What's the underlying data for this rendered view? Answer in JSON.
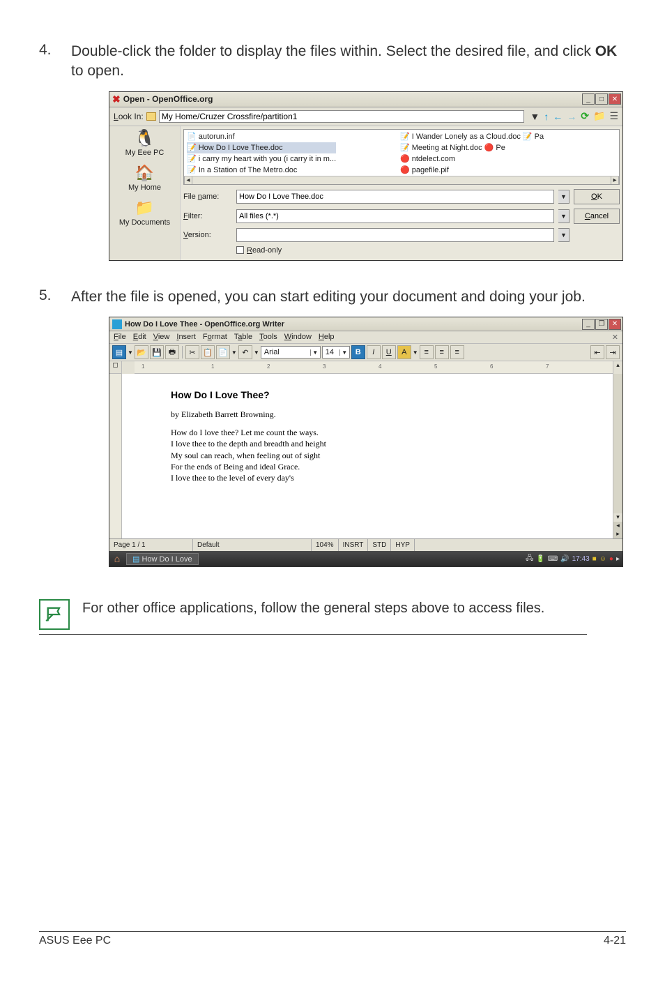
{
  "steps": {
    "s4": {
      "num": "4.",
      "text_a": "Double-click the folder to display the files within. Select the desired file, and click ",
      "bold": "OK",
      "text_b": " to open."
    },
    "s5": {
      "num": "5.",
      "text": "After the file is opened, you can start editing your document and doing your job."
    }
  },
  "open_dialog": {
    "title": "Open - OpenOffice.org",
    "lookin_label": "Look In:",
    "lookin_value": "My Home/Cruzer Crossfire/partition1",
    "places": {
      "eeepc": "My Eee PC",
      "home": "My Home",
      "docs": "My Documents"
    },
    "files_left": [
      {
        "ico": "📄",
        "name": "autorun.inf"
      },
      {
        "ico": "📝",
        "name": "How Do I Love Thee.doc",
        "selected": true
      },
      {
        "ico": "📝",
        "name": "i carry my heart with you (i carry it in m..."
      },
      {
        "ico": "📝",
        "name": "In a Station of The Metro.doc"
      }
    ],
    "files_right": [
      {
        "ico": "📝",
        "name": "I Wander Lonely as a Cloud.doc 📝 Pa"
      },
      {
        "ico": "📝",
        "name": "Meeting at Night.doc                      🔴 Pe"
      },
      {
        "ico": "🔴",
        "name": "ntdelect.com"
      },
      {
        "ico": "🔴",
        "name": "pagefile.pif"
      }
    ],
    "filename_label": "File name:",
    "filename_value": "How Do I Love Thee.doc",
    "filter_label": "Filter:",
    "filter_value": "All files (*.*)",
    "version_label": "Version:",
    "version_value": "",
    "readonly_label": "Read-only",
    "ok": "OK",
    "cancel": "Cancel"
  },
  "writer": {
    "title": "How Do I Love Thee - OpenOffice.org Writer",
    "menus": {
      "file": "File",
      "edit": "Edit",
      "view": "View",
      "insert": "Insert",
      "format": "Format",
      "table": "Table",
      "tools": "Tools",
      "window": "Window",
      "help": "Help"
    },
    "font": "Arial",
    "size": "14",
    "doc_title": "How Do I Love Thee?",
    "doc_author": "by Elizabeth Barrett Browning.",
    "doc_lines": [
      "How do I love thee? Let me count the ways.",
      "I love thee to the depth and breadth and height",
      "My soul can reach, when feeling out of sight",
      "For the ends of Being and ideal Grace.",
      "I love thee to the level of every day's"
    ],
    "status": {
      "page": "Page 1 / 1",
      "style": "Default",
      "zoom": "104%",
      "insrt": "INSRT",
      "std": "STD",
      "hyp": "HYP"
    },
    "taskbar_label": "How Do I Love",
    "time": "17:43"
  },
  "note": "For other office applications, follow the general steps above to access files.",
  "footer": {
    "left": "ASUS Eee PC",
    "right": "4-21"
  }
}
